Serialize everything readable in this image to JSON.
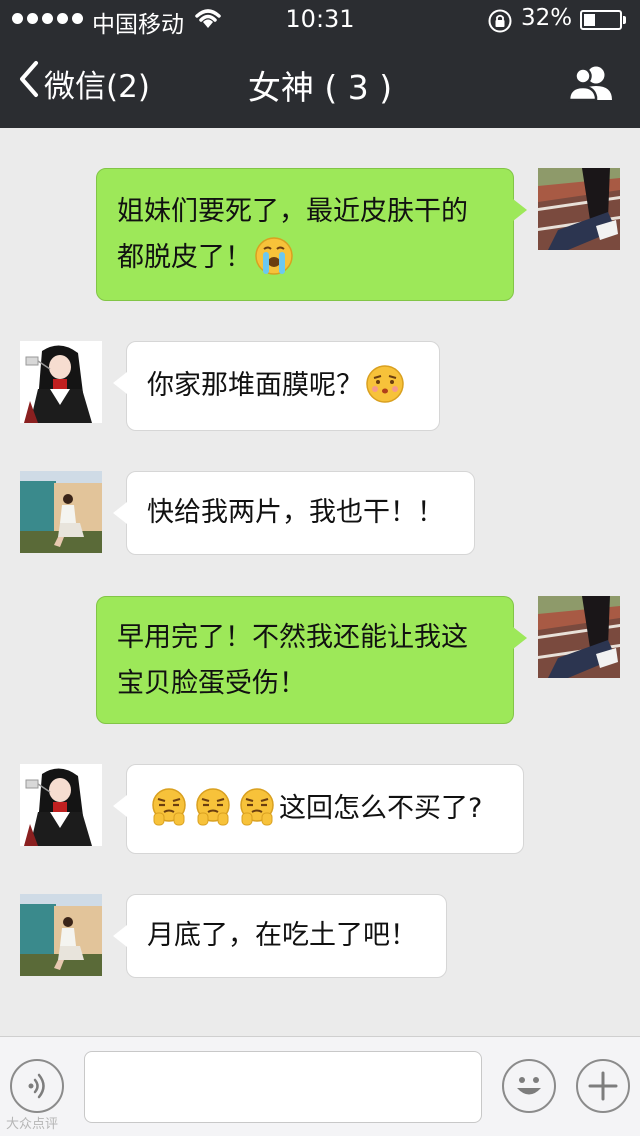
{
  "status_bar": {
    "carrier": "中国移动",
    "time": "10:31",
    "battery": "32%",
    "battery_level": 0.32
  },
  "nav": {
    "back_label": "微信(2)",
    "title": "女神 ( 3 )"
  },
  "messages": [
    {
      "side": "right",
      "avatar": "track-girl-avatar",
      "text": "姐妹们要死了，最近皮肤干的都脱皮了！",
      "line1": "姐妹们要死了，最近皮肤干的",
      "line2": "都脱皮了！",
      "emoji": "crying-face-emoji"
    },
    {
      "side": "left",
      "avatar": "anime-girl-avatar",
      "text": "你家那堆面膜呢？",
      "emoji": "thinking-face-emoji"
    },
    {
      "side": "left",
      "avatar": "sitting-girl-avatar",
      "text": "快给我两片，我也干！！"
    },
    {
      "side": "right",
      "avatar": "track-girl-avatar",
      "line1": "早用完了！不然我还能让我这",
      "line2": "宝贝脸蛋受伤！"
    },
    {
      "side": "left",
      "avatar": "anime-girl-avatar",
      "emoji": "grumpy-face-emoji",
      "emoji_count": 3,
      "text": "这回怎么不买了?"
    },
    {
      "side": "left",
      "avatar": "sitting-girl-avatar",
      "text": "月底了，在吃土了吧！"
    }
  ],
  "input": {
    "value": "",
    "placeholder": ""
  },
  "icons": {
    "voice": "voice-icon",
    "emoji": "emoji-icon",
    "plus": "plus-icon",
    "members": "members-icon",
    "back": "back-chevron-icon"
  },
  "watermark": "大众点评",
  "colors": {
    "topbar": "#2b2d31",
    "background": "#ebebeb",
    "sent_bubble": "#9de859",
    "received_bubble": "#ffffff"
  }
}
